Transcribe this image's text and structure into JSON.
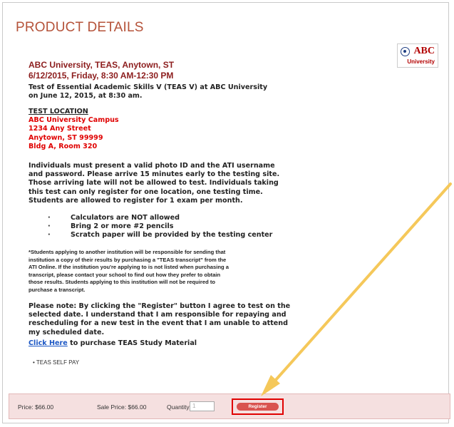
{
  "page": {
    "title": "PRODUCT DETAILS"
  },
  "logo": {
    "name": "ABC",
    "sub": "University"
  },
  "schedule": {
    "line1": "ABC University, TEAS, Anytown, ST",
    "line2": "6/12/2015, Friday, 8:30 AM-12:30 PM"
  },
  "intro": {
    "line1": "Test of Essential Academic Skills V (TEAS V) at ABC University",
    "line2": "on June 12, 2015, at 8:30 am."
  },
  "location": {
    "heading": "TEST LOCATION",
    "lines": [
      "ABC University Campus",
      "1234 Any Street",
      "Anytown, ST 99999",
      "Bldg A, Room 320"
    ]
  },
  "requirements": [
    "Individuals must present a valid photo ID and the ATI username",
    "and password. Please arrive 15 minutes early to the testing site.",
    "Those arriving late will not be allowed to test. Individuals taking",
    "this test can only register for one location, one testing time.",
    "Students are allowed to register for 1 exam per month."
  ],
  "bullets": [
    "Calculators are NOT allowed",
    "Bring 2 or more #2 pencils",
    "Scratch paper will be provided by the testing center"
  ],
  "transcript": [
    "*Students applying to another institution will be responsible for sending that",
    "institution a copy of their results by purchasing a \"TEAS transcript\" from the",
    "ATI Online. If the institution you're applying to is not listed when purchasing a",
    "transcript, please contact your school to find out how they prefer to obtain",
    "those results. Students applying to this institution will not be required to",
    "purchase a transcript."
  ],
  "note": [
    "Please note: By clicking the \"Register\" button I agree to test on the",
    "selected date. I understand that I am responsible for repaying and",
    "rescheduling for a new test in the event that I am unable to attend",
    "my scheduled date."
  ],
  "study": {
    "link": "Click Here",
    "text": " to purchase TEAS Study Material"
  },
  "self_pay": "• TEAS SELF PAY",
  "footer": {
    "price": "Price: $66.00",
    "sale_price": "Sale Price: $66.00",
    "quantity_label": "Quantity:",
    "quantity_value": "1",
    "register": "Register"
  },
  "colors": {
    "title": "#b5533a",
    "schedule": "#8c1d1d",
    "location": "#e00000",
    "arrow": "#f5c85a",
    "footer_bg": "#f5e0e0"
  }
}
